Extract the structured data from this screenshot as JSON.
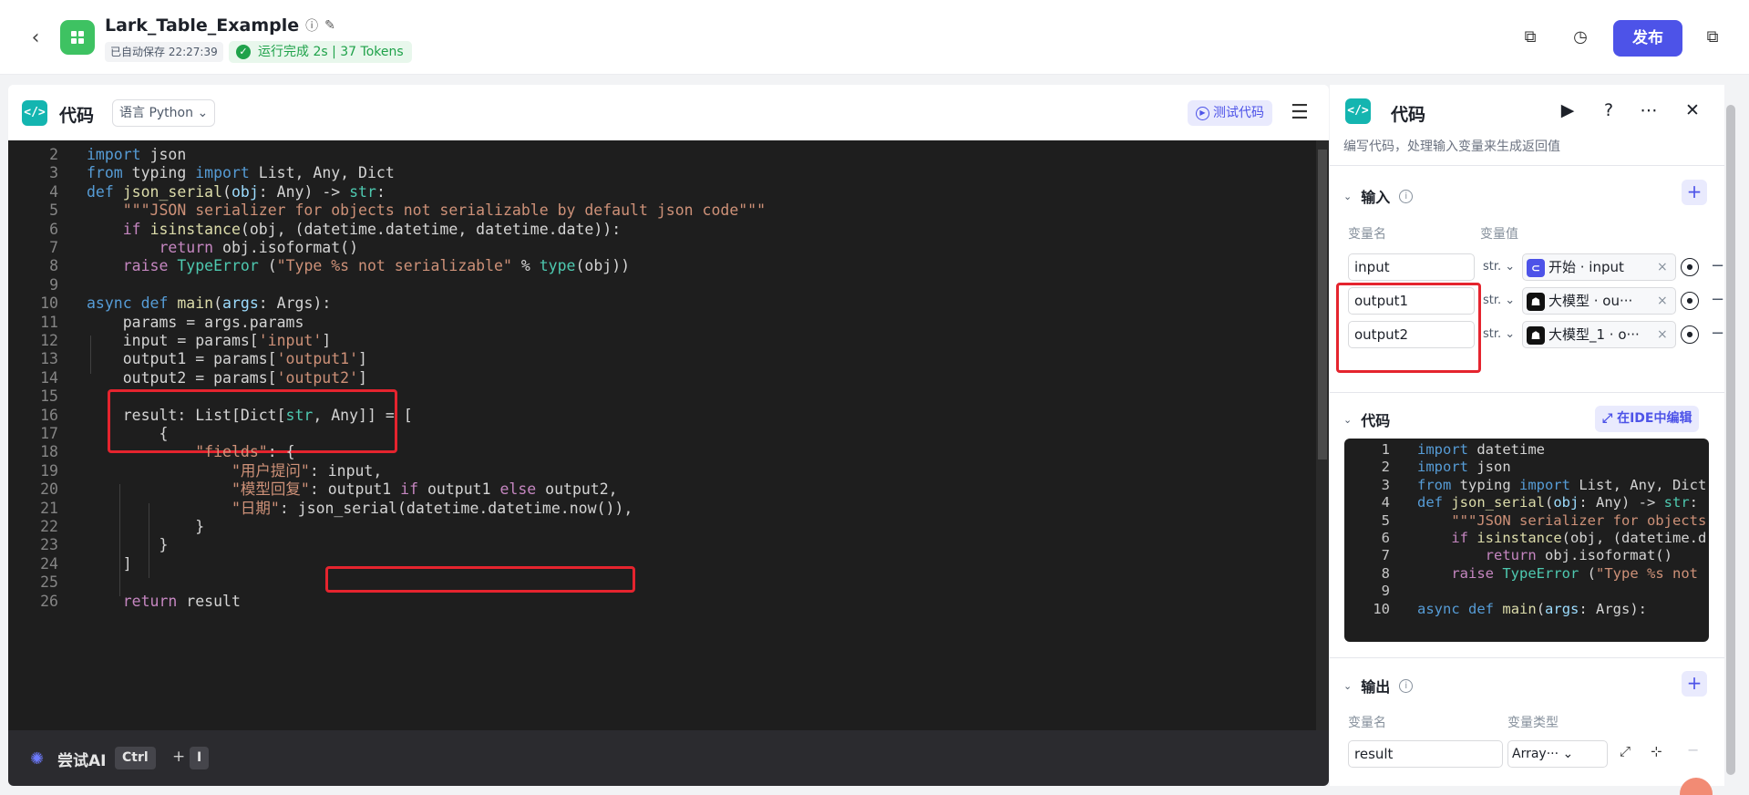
{
  "header": {
    "app_title": "Lark_Table_Example",
    "autosave": "已自动保存 22:27:39",
    "run_status": "运行完成 2s | 37 Tokens",
    "publish_label": "发布"
  },
  "editor": {
    "title": "代码",
    "language": "语言 Python",
    "test_label": "测试代码",
    "lines": [
      {
        "n": "2",
        "html": "<span class=\"k\">import</span> json"
      },
      {
        "n": "3",
        "html": "<span class=\"k\">from</span> typing <span class=\"k\">import</span> List, Any, Dict"
      },
      {
        "n": "4",
        "html": "<span class=\"k\">def</span> <span class=\"f\">json_serial</span>(<span class=\"p\">obj</span>: Any) -&gt; <span class=\"t\">str</span>:"
      },
      {
        "n": "5",
        "html": "    <span class=\"s\">\"\"\"JSON serializer for objects not serializable by default json code\"\"\"</span>"
      },
      {
        "n": "6",
        "html": "    <span class=\"kp\">if</span> <span class=\"f\">isinstance</span>(obj, (datetime.datetime, datetime.date)):"
      },
      {
        "n": "7",
        "html": "        <span class=\"kp\">return</span> obj.isoformat()"
      },
      {
        "n": "8",
        "html": "    <span class=\"kp\">raise</span> <span class=\"t\">TypeError</span> (<span class=\"s\">\"Type %s not serializable\"</span> % <span class=\"t\">type</span>(obj))"
      },
      {
        "n": "9",
        "html": ""
      },
      {
        "n": "10",
        "html": "<span class=\"k\">async</span> <span class=\"k\">def</span> <span class=\"f\">main</span>(<span class=\"p\">args</span>: Args):"
      },
      {
        "n": "11",
        "html": "    params = args.params"
      },
      {
        "n": "12",
        "html": "    input = params[<span class=\"s\">'input'</span>]"
      },
      {
        "n": "13",
        "html": "    output1 = params[<span class=\"s\">'output1'</span>]"
      },
      {
        "n": "14",
        "html": "    output2 = params[<span class=\"s\">'output2'</span>]"
      },
      {
        "n": "15",
        "html": ""
      },
      {
        "n": "16",
        "html": "    result: List[Dict[<span class=\"t\">str</span>, Any]] = ["
      },
      {
        "n": "17",
        "html": "        {"
      },
      {
        "n": "18",
        "html": "            <span class=\"s\">\"fields\"</span>: {"
      },
      {
        "n": "19",
        "html": "                <span class=\"s\">\"用户提问\"</span>: input,"
      },
      {
        "n": "20",
        "html": "                <span class=\"s\">\"模型回复\"</span>: output1 <span class=\"kp\">if</span> output1 <span class=\"kp\">else</span> output2,"
      },
      {
        "n": "21",
        "html": "                <span class=\"s\">\"日期\"</span>: json_serial(datetime.datetime.now()),"
      },
      {
        "n": "22",
        "html": "            }"
      },
      {
        "n": "23",
        "html": "        }"
      },
      {
        "n": "24",
        "html": "    ]"
      },
      {
        "n": "25",
        "html": ""
      },
      {
        "n": "26",
        "html": "    <span class=\"kp\">return</span> result"
      }
    ]
  },
  "ai_bar": {
    "label": "尝试AI",
    "key1": "Ctrl",
    "plus": "+",
    "key2": "I"
  },
  "panel": {
    "title": "代码",
    "description": "编写代码，处理输入变量来生成返回值",
    "input_section": "输入",
    "col_name": "变量名",
    "col_value": "变量值",
    "inputs": [
      {
        "name": "input",
        "type": "str.",
        "ref": "开始 · input"
      },
      {
        "name": "output1",
        "type": "str.",
        "ref": "大模型 · ou···"
      },
      {
        "name": "output2",
        "type": "str.",
        "ref": "大模型_1 · o···"
      }
    ],
    "code_section": "代码",
    "ide_label": "在IDE中编辑",
    "mini_lines": [
      {
        "n": "1",
        "html": "<span class=\"k\">import</span> datetime"
      },
      {
        "n": "2",
        "html": "<span class=\"k\">import</span> json"
      },
      {
        "n": "3",
        "html": "<span class=\"k\">from</span> typing <span class=\"k\">import</span> List, Any, Dict"
      },
      {
        "n": "4",
        "html": "<span class=\"k\">def</span> <span class=\"f\">json_serial</span>(<span class=\"p\">obj</span>: Any) -&gt; <span class=\"t\">str</span>:"
      },
      {
        "n": "5",
        "html": "    <span class=\"s\">\"\"\"JSON serializer for objects</span>"
      },
      {
        "n": "6",
        "html": "    <span class=\"kp\">if</span> <span class=\"f\">isinstance</span>(obj, (datetime.d"
      },
      {
        "n": "7",
        "html": "        <span class=\"kp\">return</span> obj.isoformat()"
      },
      {
        "n": "8",
        "html": "    <span class=\"kp\">raise</span> <span class=\"t\">TypeError</span> (<span class=\"s\">\"Type %s not</span>"
      },
      {
        "n": "9",
        "html": ""
      },
      {
        "n": "10",
        "html": "<span class=\"k\">async</span> <span class=\"k\">def</span> <span class=\"f\">main</span>(<span class=\"p\">args</span>: Args):"
      }
    ],
    "output_section": "输出",
    "out_col_name": "变量名",
    "out_col_type": "变量类型",
    "output": {
      "name": "result",
      "type": "Array···"
    }
  },
  "icons": [
    "back-icon",
    "info-icon",
    "edit-icon",
    "check-icon",
    "copy-icon",
    "history-icon",
    "duplicate-icon",
    "play-icon",
    "help-icon",
    "more-icon",
    "close-icon"
  ]
}
